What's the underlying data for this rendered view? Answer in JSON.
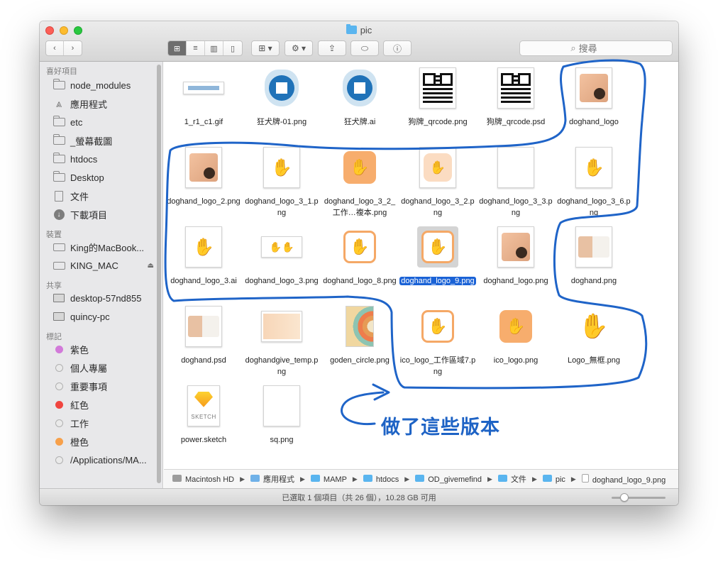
{
  "window": {
    "title": "pic"
  },
  "toolbar": {
    "nav_back": "‹",
    "nav_forward": "›",
    "view_icons": "⊞",
    "view_list": "≡",
    "view_columns": "▥",
    "view_coverflow": "▯",
    "arrange": "⊞ ▾",
    "action": "⚙ ▾",
    "share": "⇪",
    "tags": "⬭",
    "info": "ⓘ",
    "search_placeholder": "搜尋"
  },
  "sidebar": {
    "sections": [
      {
        "title": "喜好項目",
        "items": [
          {
            "label": "node_modules",
            "icon": "folder-icon"
          },
          {
            "label": "應用程式",
            "icon": "applications-icon"
          },
          {
            "label": "etc",
            "icon": "folder-icon"
          },
          {
            "label": "_螢幕截圖",
            "icon": "folder-icon"
          },
          {
            "label": "htdocs",
            "icon": "folder-icon"
          },
          {
            "label": "Desktop",
            "icon": "folder-icon"
          },
          {
            "label": "文件",
            "icon": "document-icon"
          },
          {
            "label": "下載項目",
            "icon": "downloads-icon"
          }
        ]
      },
      {
        "title": "裝置",
        "items": [
          {
            "label": "King的MacBook...",
            "icon": "laptop-icon"
          },
          {
            "label": "KING_MAC",
            "icon": "drive-icon",
            "eject": "⏏"
          }
        ]
      },
      {
        "title": "共享",
        "items": [
          {
            "label": "desktop-57nd855",
            "icon": "monitor-icon"
          },
          {
            "label": "quincy-pc",
            "icon": "monitor-icon"
          }
        ]
      },
      {
        "title": "標記",
        "items": [
          {
            "label": "紫色",
            "tag_color": "#d27ad9"
          },
          {
            "label": "個人專屬",
            "tag_color": ""
          },
          {
            "label": "重要事項",
            "tag_color": ""
          },
          {
            "label": "紅色",
            "tag_color": "#f0453f"
          },
          {
            "label": "工作",
            "tag_color": ""
          },
          {
            "label": "橙色",
            "tag_color": "#f7a04a"
          },
          {
            "label": "/Applications/MA...",
            "tag_color": ""
          }
        ]
      }
    ]
  },
  "files": [
    {
      "name": "1_r1_c1.gif",
      "kind": "wide-banner"
    },
    {
      "name": "狂犬牌-01.png",
      "kind": "blue-tag"
    },
    {
      "name": "狂犬牌.ai",
      "kind": "blue-tag"
    },
    {
      "name": "狗牌_qrcode.png",
      "kind": "qr"
    },
    {
      "name": "狗牌_qrcode.psd",
      "kind": "qr"
    },
    {
      "name": "doghand_logo",
      "kind": "photo-hand"
    },
    {
      "name": "doghand_logo_2.png",
      "kind": "photo-hand"
    },
    {
      "name": "doghand_logo_3_1.png",
      "kind": "bw-paw"
    },
    {
      "name": "doghand_logo_3_2_工作…複本.png",
      "kind": "orange-card"
    },
    {
      "name": "doghand_logo_3_2.png",
      "kind": "light-orange"
    },
    {
      "name": "doghand_logo_3_3.png",
      "kind": "blank"
    },
    {
      "name": "doghand_logo_3_6.png",
      "kind": "bw-paw"
    },
    {
      "name": "doghand_logo_3.ai",
      "kind": "bw-paw"
    },
    {
      "name": "doghand_logo_3.png",
      "kind": "small-outline"
    },
    {
      "name": "doghand_logo_8.png",
      "kind": "orange-outline"
    },
    {
      "name": "doghand_logo_9.png",
      "kind": "orange-outline",
      "selected": true
    },
    {
      "name": "doghand_logo.png",
      "kind": "photo-hand"
    },
    {
      "name": "doghand.png",
      "kind": "photo-dog"
    },
    {
      "name": "doghand.psd",
      "kind": "photo-dog"
    },
    {
      "name": "doghandgive_temp.png",
      "kind": "landscape-photo"
    },
    {
      "name": "goden_circle.png",
      "kind": "circle-art"
    },
    {
      "name": "ico_logo_工作區域7.png",
      "kind": "orange-outline"
    },
    {
      "name": "ico_logo.png",
      "kind": "orange-card"
    },
    {
      "name": "Logo_無框.png",
      "kind": "bw-paw-plain"
    },
    {
      "name": "power.sketch",
      "kind": "sketch"
    },
    {
      "name": "sq.png",
      "kind": "blank"
    }
  ],
  "pathbar": [
    {
      "label": "Macintosh HD",
      "icon": "hd"
    },
    {
      "label": "應用程式",
      "icon": "app"
    },
    {
      "label": "MAMP",
      "icon": "folder"
    },
    {
      "label": "htdocs",
      "icon": "folder"
    },
    {
      "label": "OD_givemefind",
      "icon": "folder"
    },
    {
      "label": "文件",
      "icon": "folder"
    },
    {
      "label": "pic",
      "icon": "folder"
    },
    {
      "label": "doghand_logo_9.png",
      "icon": "file"
    }
  ],
  "status": {
    "text": "已選取 1 個項目（共 26 個），10.28 GB 可用"
  },
  "annotation": {
    "text": "做了這些版本",
    "color": "#1e63c5"
  }
}
